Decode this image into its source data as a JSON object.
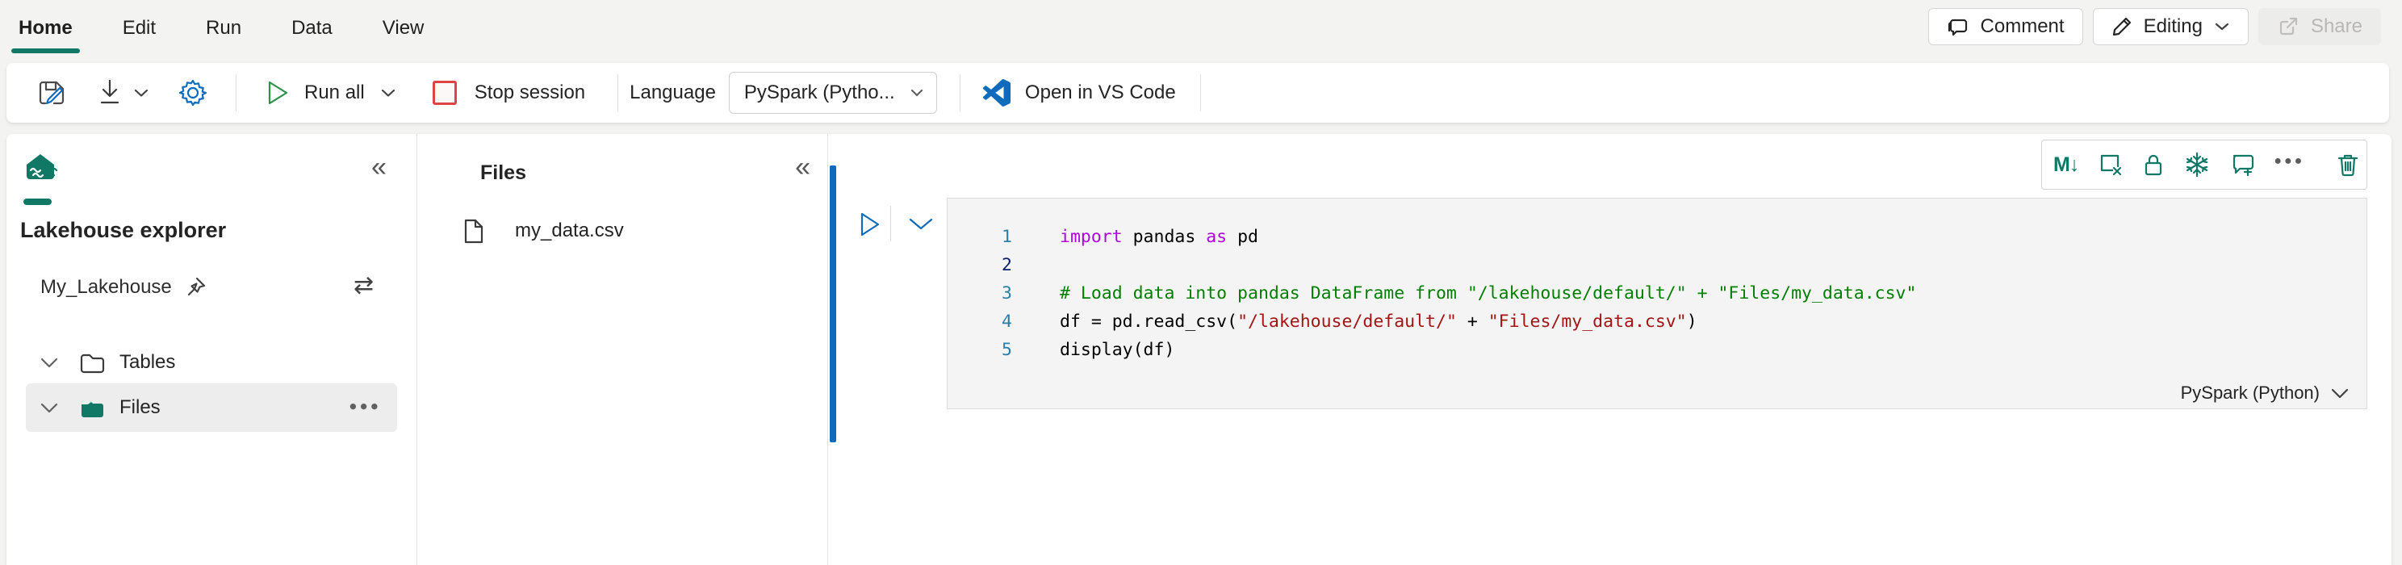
{
  "menu": {
    "items": [
      {
        "label": "Home"
      },
      {
        "label": "Edit"
      },
      {
        "label": "Run"
      },
      {
        "label": "Data"
      },
      {
        "label": "View"
      }
    ]
  },
  "topbar": {
    "comment": "Comment",
    "editing": "Editing",
    "share": "Share"
  },
  "ribbon": {
    "run_all": "Run all",
    "stop": "Stop session",
    "language_label": "Language",
    "language_value": "PySpark (Pytho...",
    "open_vscode": "Open in VS Code"
  },
  "explorer": {
    "title": "Lakehouse explorer",
    "lakehouse": "My_Lakehouse",
    "tables": "Tables",
    "files": "Files",
    "more": "●●●",
    "collapse": "«",
    "swap": "⇄"
  },
  "files_panel": {
    "title": "Files",
    "collapse": "«",
    "file": "my_data.csv"
  },
  "cell": {
    "markdown_glyph": "M↓",
    "language": "PySpark (Python)",
    "lines": [
      {
        "n": "1",
        "tokens": [
          {
            "t": "import",
            "c": "kw"
          },
          {
            "t": " pandas ",
            "c": "pl"
          },
          {
            "t": "as",
            "c": "kw"
          },
          {
            "t": " pd",
            "c": "pl"
          }
        ]
      },
      {
        "n": "2",
        "tokens": []
      },
      {
        "n": "3",
        "tokens": [
          {
            "t": "# Load data into pandas DataFrame from \"/lakehouse/default/\" + \"Files/my_data.csv\"",
            "c": "cm"
          }
        ]
      },
      {
        "n": "4",
        "tokens": [
          {
            "t": "df = pd.read_csv(",
            "c": "pl"
          },
          {
            "t": "\"/lakehouse/default/\"",
            "c": "st"
          },
          {
            "t": " + ",
            "c": "pl"
          },
          {
            "t": "\"Files/my_data.csv\"",
            "c": "st"
          },
          {
            "t": ")",
            "c": "pl"
          }
        ]
      },
      {
        "n": "5",
        "tokens": [
          {
            "t": "display(df)",
            "c": "pl"
          }
        ]
      }
    ]
  },
  "colors": {
    "accent_teal": "#117865",
    "accent_blue": "#0f6cbd",
    "run_green": "#2b9348",
    "stop_red": "#e04343",
    "code_keyword": "#af00db",
    "code_comment": "#008000",
    "code_string": "#a31515"
  }
}
